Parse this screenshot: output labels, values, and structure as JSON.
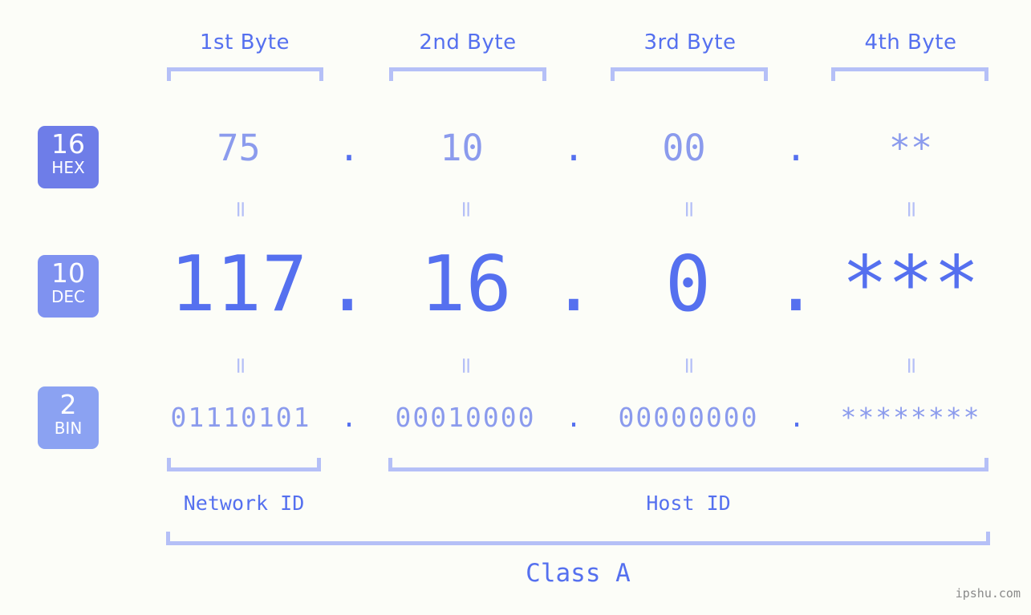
{
  "watermark": "ipshu.com",
  "class_label": "Class A",
  "byte_headers": [
    {
      "label": "1st Byte"
    },
    {
      "label": "2nd Byte"
    },
    {
      "label": "3rd Byte"
    },
    {
      "label": "4th Byte"
    }
  ],
  "bases": [
    {
      "num": "16",
      "abbr": "HEX",
      "color": "#6e7de8"
    },
    {
      "num": "10",
      "abbr": "DEC",
      "color": "#7f92f0"
    },
    {
      "num": "2",
      "abbr": "BIN",
      "color": "#8ba2f2"
    }
  ],
  "separator": "=",
  "dot": ".",
  "rows": {
    "hex": {
      "values": [
        "75",
        "10",
        "00",
        "**"
      ]
    },
    "dec": {
      "values": [
        "117",
        "16",
        "0",
        "***"
      ]
    },
    "bin": {
      "values": [
        "01110101",
        "00010000",
        "00000000",
        "********"
      ]
    }
  },
  "id_labels": [
    {
      "label": "Network ID"
    },
    {
      "label": "Host ID"
    }
  ],
  "colors": {
    "background": "#fcfdf8",
    "accent_strong": "#5570ef",
    "accent_light": "#8b9bed",
    "bracket": "#b5c0f7",
    "watermark": "#8a8a8a"
  }
}
